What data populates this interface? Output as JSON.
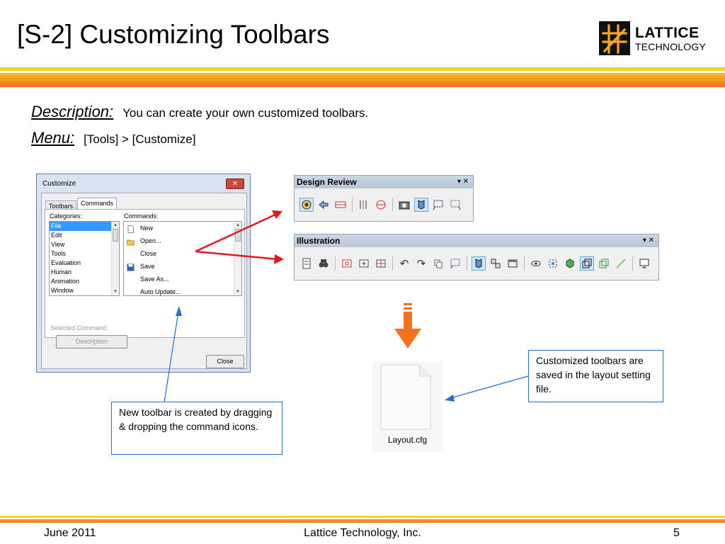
{
  "slide": {
    "title": "[S-2] Customizing Toolbars",
    "logo": {
      "line1": "LATTICE",
      "line2": "TECHNOLOGY"
    }
  },
  "info": {
    "description_label": "Description:",
    "description_text": "You can create your own customized toolbars.",
    "menu_label": "Menu:",
    "menu_text": "[Tools] > [Customize]"
  },
  "dialog": {
    "title": "Customize",
    "tabs": [
      "Toolbars",
      "Commands"
    ],
    "categories_label": "Categories:",
    "categories": [
      "File",
      "Edit",
      "View",
      "Tools",
      "Evaluation",
      "Human",
      "Animation",
      "Window"
    ],
    "commands_label": "Commands:",
    "commands": [
      {
        "label": "New",
        "icon": "new-file-icon"
      },
      {
        "label": "Open...",
        "icon": "open-folder-icon"
      },
      {
        "label": "Close",
        "icon": ""
      },
      {
        "label": "Save",
        "icon": "save-disk-icon"
      },
      {
        "label": "Save As...",
        "icon": ""
      },
      {
        "label": "Auto Update...",
        "icon": ""
      }
    ],
    "selected_command_label": "Selected Command:",
    "description_button": "Description",
    "close_button": "Close",
    "close_x": "✕"
  },
  "toolbars": {
    "design_review": {
      "title": "Design Review",
      "controls": "▾ ✕"
    },
    "illustration": {
      "title": "Illustration",
      "controls": "▾ ✕"
    }
  },
  "callouts": {
    "left": "New toolbar is created by dragging & dropping the command icons.",
    "right": "Customized toolbars are saved in the layout setting file."
  },
  "file": {
    "name": "Layout.cfg"
  },
  "footer": {
    "date": "June 2011",
    "company": "Lattice Technology, Inc.",
    "page": "5"
  },
  "colors": {
    "accent_orange": "#f3731f",
    "band_yellow": "#fcd21a",
    "arrow_red": "#e0191f",
    "callout_blue": "#1f6fd1"
  }
}
